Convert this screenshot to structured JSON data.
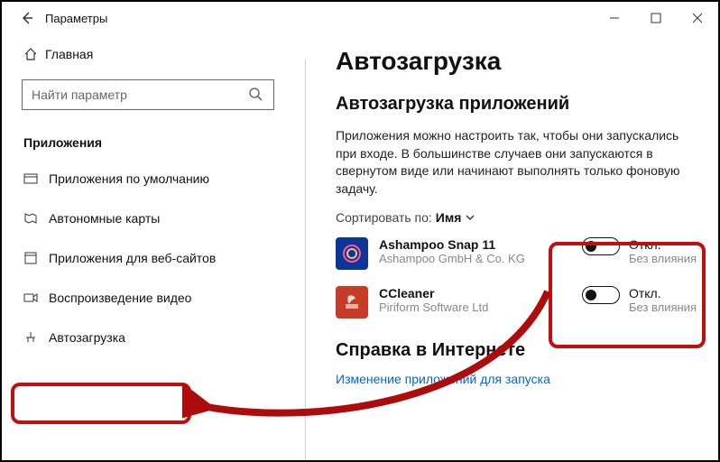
{
  "window_title": "Параметры",
  "home_label": "Главная",
  "search_placeholder": "Найти параметр",
  "section": "Приложения",
  "nav": {
    "default_apps": "Приложения по умолчанию",
    "offline_maps": "Автономные карты",
    "web_apps": "Приложения для веб-сайтов",
    "video": "Воспроизведение видео",
    "startup": "Автозагрузка"
  },
  "page_title": "Автозагрузка",
  "subtitle": "Автозагрузка приложений",
  "description": "Приложения можно настроить так, чтобы они запускались при входе. В большинстве случаев они запускаются в свернутом виде или начинают выполнять только фоновую задачу.",
  "sort_label": "Сортировать по:",
  "sort_value": "Имя",
  "apps": [
    {
      "name": "Ashampoo Snap 11",
      "publisher": "Ashampoo GmbH & Co. KG",
      "state": "Откл.",
      "impact": "Без влияния"
    },
    {
      "name": "CCleaner",
      "publisher": "Piriform Software Ltd",
      "state": "Откл.",
      "impact": "Без влияния"
    }
  ],
  "internet_help_title": "Справка в Интернете",
  "help_link": "Изменение приложений для запуска"
}
